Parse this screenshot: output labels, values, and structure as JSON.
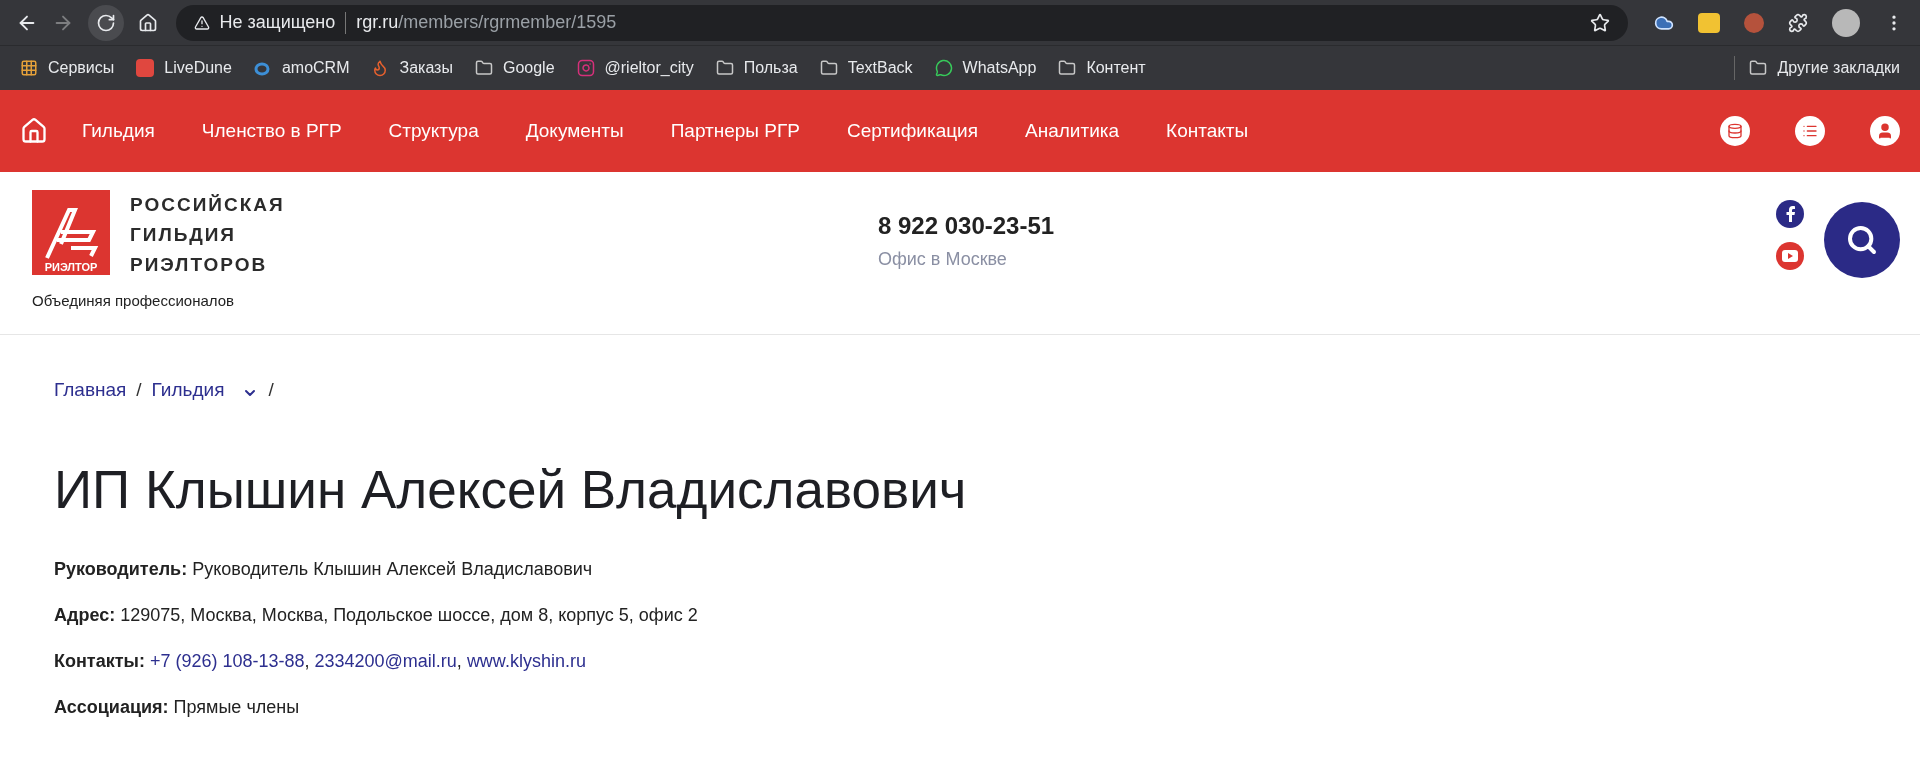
{
  "browser": {
    "back_enabled": true,
    "forward_enabled": false,
    "security": "Не защищено",
    "url_host": "rgr.ru",
    "url_path": "/members/rgrmember/1595",
    "bookmarks": [
      {
        "kind": "apps",
        "label": "Сервисы"
      },
      {
        "kind": "ld",
        "label": "LiveDune"
      },
      {
        "kind": "amo",
        "label": "amoCRM"
      },
      {
        "kind": "orders",
        "label": "Заказы"
      },
      {
        "kind": "folder",
        "label": "Google"
      },
      {
        "kind": "instagram",
        "label": "@rieltor_city"
      },
      {
        "kind": "folder",
        "label": "Польза"
      },
      {
        "kind": "folder",
        "label": "TextBack"
      },
      {
        "kind": "whatsapp",
        "label": "WhatsApp"
      },
      {
        "kind": "folder",
        "label": "Контент"
      }
    ],
    "other_bookmarks": "Другие закладки"
  },
  "nav": {
    "items": [
      "Гильдия",
      "Членство в РГР",
      "Структура",
      "Документы",
      "Партнеры РГР",
      "Сертификация",
      "Аналитика",
      "Контакты"
    ]
  },
  "header": {
    "logo_lines": [
      "РОССИЙСКАЯ",
      "ГИЛЬДИЯ",
      "РИЭЛТОРОВ"
    ],
    "logo_badge": "РИЭЛТОР",
    "tagline": "Объединяя профессионалов",
    "phone": "8 922 030-23-51",
    "office": "Офис в Москве"
  },
  "breadcrumbs": [
    {
      "label": "Главная",
      "dropdown": false,
      "separator": "/"
    },
    {
      "label": "Гильдия",
      "dropdown": true,
      "separator": "/"
    }
  ],
  "title": "ИП Клышин Алексей Владиславович",
  "details": [
    {
      "kind": "text",
      "label": "Руководитель:",
      "value": "Руководитель Клышин Алексей Владиславович"
    },
    {
      "kind": "text",
      "label": "Адрес:",
      "value": "129075, Москва, Москва, Подольское шоссе, дом 8, корпус 5, офис 2"
    },
    {
      "kind": "links",
      "label": "Контакты:",
      "links": [
        {
          "text": "+7 (926) 108-13-88",
          "after": ","
        },
        {
          "text": "2334200@mail.ru",
          "after": ","
        },
        {
          "text": "www.klyshin.ru"
        }
      ]
    },
    {
      "kind": "text",
      "label": "Ассоциация:",
      "value": "Прямые члены"
    }
  ]
}
